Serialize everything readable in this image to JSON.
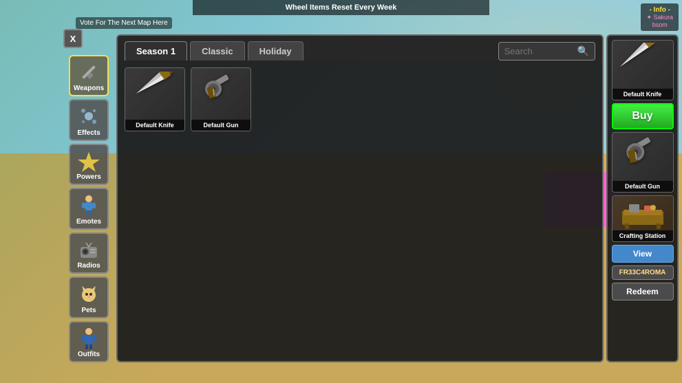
{
  "background": {
    "top_banner": "Wheel Items Reset Every Week",
    "vote_banner": "Vote For The Next Map Here"
  },
  "info_panel": {
    "title": "- Info -",
    "item1": "✦ Sakura",
    "item2": "bsom"
  },
  "sidebar": {
    "close_label": "X",
    "items": [
      {
        "id": "weapons",
        "label": "Weapons",
        "active": true
      },
      {
        "id": "effects",
        "label": "Effects",
        "active": false
      },
      {
        "id": "powers",
        "label": "Powers",
        "active": false
      },
      {
        "id": "emotes",
        "label": "Emotes",
        "active": false
      },
      {
        "id": "radios",
        "label": "Radios",
        "active": false
      },
      {
        "id": "pets",
        "label": "Pets",
        "active": false
      },
      {
        "id": "outfits",
        "label": "Outfits",
        "active": false
      }
    ]
  },
  "tabs": {
    "items": [
      {
        "id": "season1",
        "label": "Season 1",
        "active": true
      },
      {
        "id": "classic",
        "label": "Classic",
        "active": false
      },
      {
        "id": "holiday",
        "label": "Holiday",
        "active": false
      }
    ],
    "search_placeholder": "Search"
  },
  "items_grid": [
    {
      "id": "default-knife",
      "label": "Default Knife"
    },
    {
      "id": "default-gun",
      "label": "Default Gun"
    }
  ],
  "right_panel": {
    "preview1": {
      "label": "Default Knife"
    },
    "buy_label": "Buy",
    "preview2": {
      "label": "Default Gun"
    },
    "crafting": {
      "label": "Crafting Station",
      "view_label": "View"
    },
    "redeem_code": "FR33C4ROMA",
    "redeem_label": "Redeem"
  }
}
